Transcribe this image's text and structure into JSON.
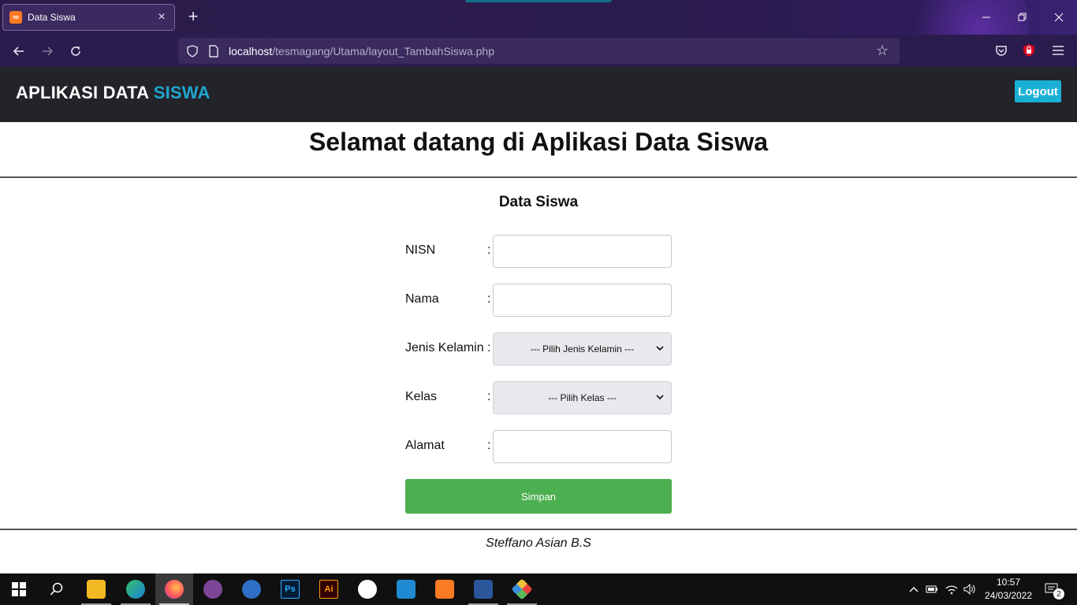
{
  "browser": {
    "tab_title": "Data Siswa",
    "tab_favicon": "xampp-icon",
    "url_host": "localhost",
    "url_path": "/tesmagang/Utama/layout_TambahSiswa.php"
  },
  "header": {
    "title_main": "APLIKASI DATA ",
    "title_accent": "SISWA",
    "logout_label": "Logout",
    "accent_color": "#1fa6cf"
  },
  "page": {
    "welcome": "Selamat datang di Aplikasi Data Siswa",
    "form_title": "Data Siswa"
  },
  "form": {
    "nisn": {
      "label": "NISN",
      "colon": ":",
      "value": ""
    },
    "nama": {
      "label": "Nama",
      "colon": ":",
      "value": ""
    },
    "jenis_kelamin": {
      "label": "Jenis Kelamin",
      "colon": ":",
      "selected": "--- Pilih Jenis Kelamin ---"
    },
    "kelas": {
      "label": "Kelas",
      "colon": ":",
      "selected": "--- Pilih Kelas ---"
    },
    "alamat": {
      "label": "Alamat",
      "colon": ":",
      "value": ""
    },
    "submit_label": "Simpan",
    "submit_color": "#4caf50"
  },
  "footer": {
    "text": "Steffano Asian B.S"
  },
  "taskbar": {
    "apps": [
      "windows-start-icon",
      "search-icon",
      "file-explorer-icon",
      "edge-icon",
      "firefox-icon",
      "tor-icon",
      "browser-icon",
      "photoshop-icon",
      "illustrator-icon",
      "app-icon",
      "vscode-icon",
      "xampp-icon",
      "word-icon",
      "git-icon"
    ],
    "ps_label": "Ps",
    "ai_label": "Ai",
    "time": "10:57",
    "date": "24/03/2022",
    "notification_count": "2"
  }
}
